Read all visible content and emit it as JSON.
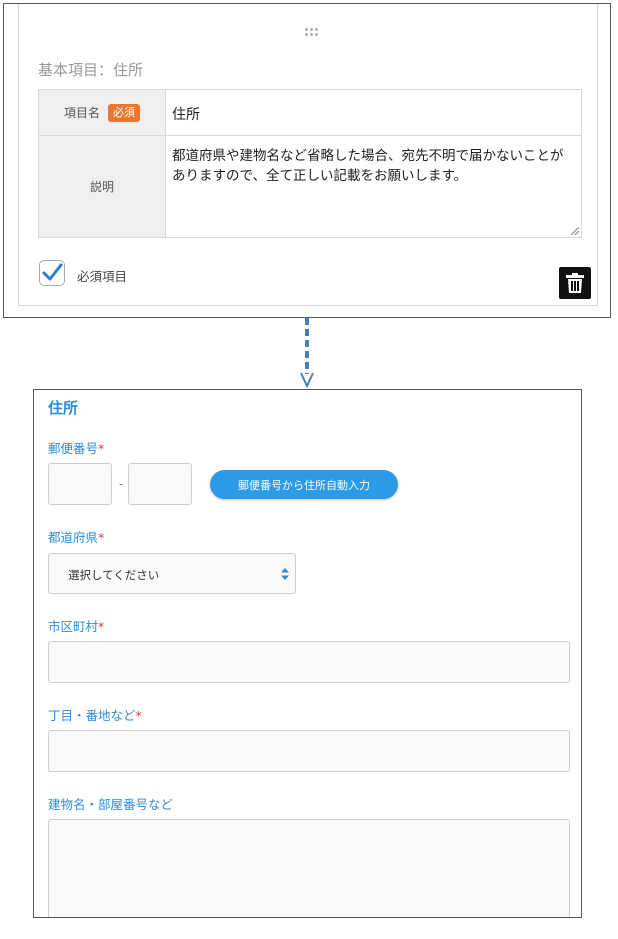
{
  "editor": {
    "section_title": "基本項目：住所",
    "field_name_label": "項目名",
    "required_badge": "必須",
    "field_name_value": "住所",
    "description_label": "説明",
    "description_value": "都道府県や建物名など省略した場合、宛先不明で届かないことがありますので、全て正しい記載をお願いします。",
    "required_checkbox_label": "必須項目",
    "required_checked": true
  },
  "preview": {
    "title": "住所",
    "postal": {
      "label": "郵便番号",
      "required_mark": "*",
      "first_value": "",
      "second_value": "",
      "separator": "-",
      "autofill_button": "郵便番号から住所自動入力"
    },
    "prefecture": {
      "label": "都道府県",
      "required_mark": "*",
      "selected": "選択してください"
    },
    "city": {
      "label": "市区町村",
      "required_mark": "*",
      "value": ""
    },
    "street": {
      "label": "丁目・番地など",
      "required_mark": "*",
      "value": ""
    },
    "building": {
      "label": "建物名・部屋番号など",
      "value": ""
    }
  },
  "colors": {
    "accent_blue": "#2e8bd8",
    "button_blue": "#2b9be8",
    "required_badge": "#e8772e",
    "required_star": "#e23b3b",
    "connector": "#4a7fb5"
  },
  "icons": [
    "drag-handle-icon",
    "checkmark-icon",
    "trash-icon",
    "arrow-down-icon",
    "select-arrows-icon"
  ]
}
